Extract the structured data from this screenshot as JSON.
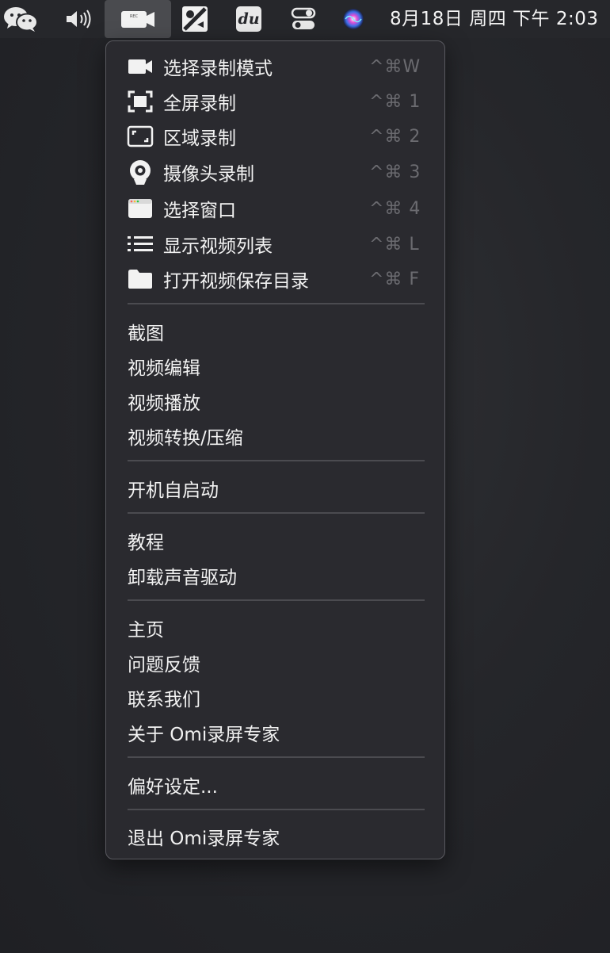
{
  "menubar": {
    "icons": [
      {
        "name": "wechat-icon"
      },
      {
        "name": "volume-icon"
      },
      {
        "name": "screen-recorder-icon"
      },
      {
        "name": "app-icon"
      },
      {
        "name": "baidu-input-icon",
        "text": "du"
      },
      {
        "name": "control-center-icon"
      },
      {
        "name": "siri-icon"
      }
    ],
    "clock": "8月18日 周四 下午 2:03",
    "recorder_badge": "REC"
  },
  "menu": {
    "items_with_icons": [
      {
        "label": "选择录制模式",
        "shortcut": "^⌘W",
        "icon": "video-camera-icon"
      },
      {
        "label": "全屏录制",
        "shortcut": "^⌘ 1",
        "icon": "fullscreen-icon"
      },
      {
        "label": "区域录制",
        "shortcut": "^⌘ 2",
        "icon": "region-icon"
      },
      {
        "label": "摄像头录制",
        "shortcut": "^⌘ 3",
        "icon": "webcam-icon"
      },
      {
        "label": "选择窗口",
        "shortcut": "^⌘ 4",
        "icon": "window-icon"
      },
      {
        "label": "显示视频列表",
        "shortcut": "^⌘ L",
        "icon": "list-icon"
      },
      {
        "label": "打开视频保存目录",
        "shortcut": "^⌘ F",
        "icon": "folder-icon"
      }
    ],
    "tools": [
      "截图",
      "视频编辑",
      "视频播放",
      "视频转换/压缩"
    ],
    "startup": [
      "开机自启动"
    ],
    "help": [
      "教程",
      "卸载声音驱动"
    ],
    "about": [
      "主页",
      "问题反馈",
      "联系我们",
      "关于 Omi录屏专家"
    ],
    "prefs": [
      "偏好设定..."
    ],
    "quit": [
      "退出 Omi录屏专家"
    ]
  },
  "colors": {
    "menu_bg": "#2a2a2f",
    "menu_text": "#f2f2f2",
    "shortcut_text": "#6b6b70",
    "separator": "#4b4b50",
    "menubar_active": "#4a4b4f"
  }
}
